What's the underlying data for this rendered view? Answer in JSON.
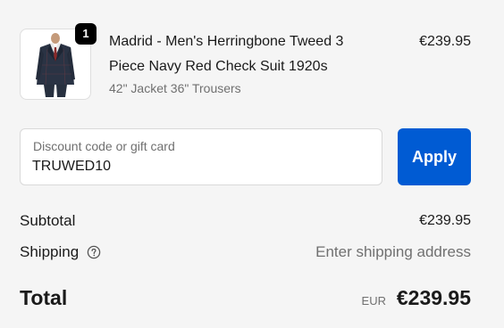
{
  "product": {
    "quantity": "1",
    "name": "Madrid - Men's Herringbone Tweed 3 Piece Navy Red Check Suit 1920s",
    "variant": "42\" Jacket 36\" Trousers",
    "price": "€239.95",
    "image_icon": "suit-product-image"
  },
  "discount": {
    "label": "Discount code or gift card",
    "value": "TRUWED10",
    "apply_label": "Apply"
  },
  "summary": {
    "subtotal_label": "Subtotal",
    "subtotal_value": "€239.95",
    "shipping_label": "Shipping",
    "shipping_help_icon": "question-circle-icon",
    "shipping_value": "Enter shipping address",
    "total_label": "Total",
    "total_currency": "EUR",
    "total_value": "€239.95"
  },
  "colors": {
    "primary_button": "#005bd3",
    "background": "#f5f5f5",
    "muted_text": "#707070",
    "badge": "#000000"
  }
}
